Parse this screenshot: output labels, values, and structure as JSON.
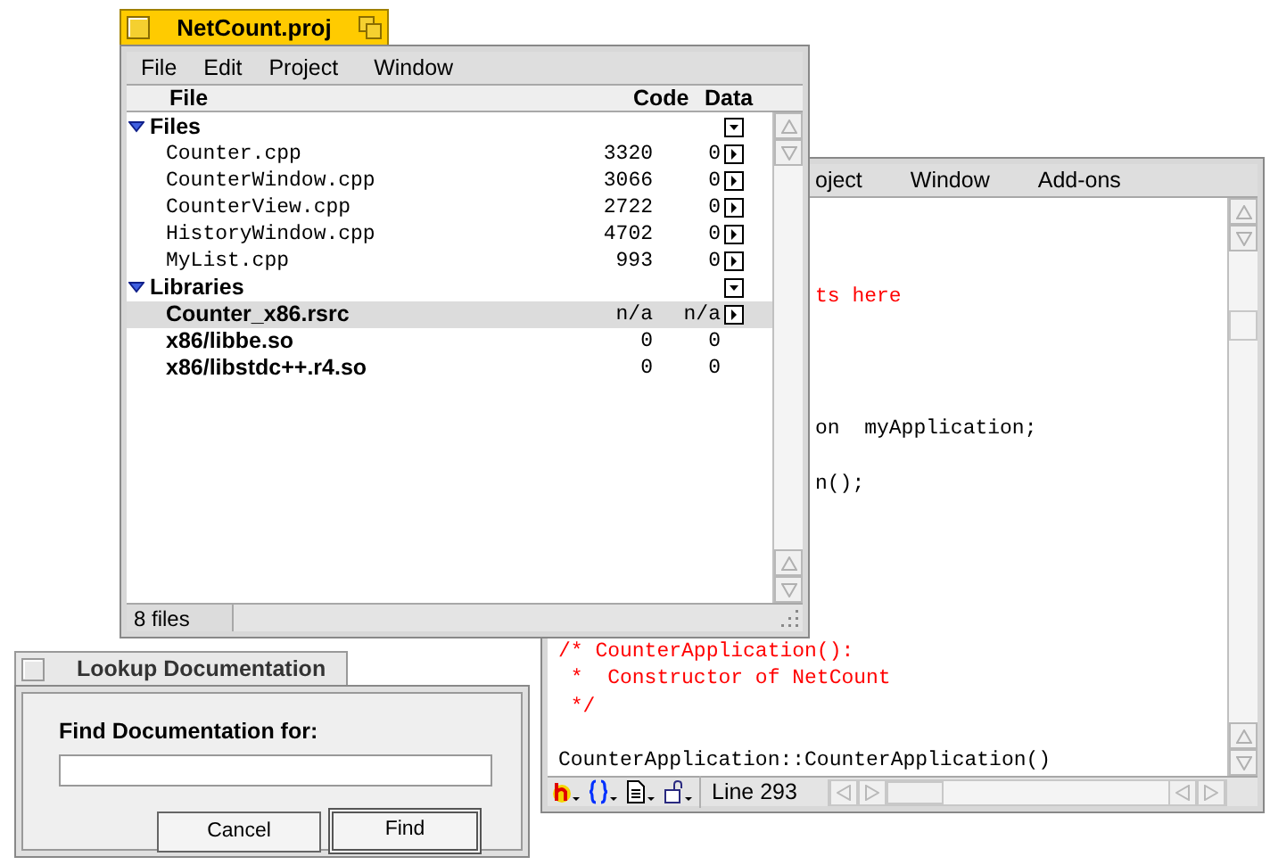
{
  "editor_window": {
    "menu": [
      "oject",
      "Window",
      "Add-ons"
    ],
    "lines_right": [
      {
        "text": "ts here",
        "kind": "comment"
      },
      {
        "text": "on  myApplication;",
        "kind": "code"
      },
      {
        "text": "n();",
        "kind": "code"
      }
    ],
    "lines_below": [
      {
        "text": "/* CounterApplication():",
        "kind": "comment"
      },
      {
        "text": " *  Constructor of NetCount",
        "kind": "comment"
      },
      {
        "text": " */",
        "kind": "comment"
      },
      {
        "text": "CounterApplication::CounterApplication()",
        "kind": "code"
      }
    ],
    "status": "Line 293"
  },
  "project_window": {
    "title": "NetCount.proj",
    "active": true,
    "menu": [
      "File",
      "Edit",
      "Project",
      "Window"
    ],
    "columns": [
      "File",
      "Code",
      "Data"
    ],
    "groups": [
      {
        "name": "Files",
        "expanded": true,
        "items": [
          {
            "name": "Counter.cpp",
            "kind": "source",
            "code": "3320",
            "data": "0",
            "has_arrow": true,
            "selected": false
          },
          {
            "name": "CounterWindow.cpp",
            "kind": "source",
            "code": "3066",
            "data": "0",
            "has_arrow": true,
            "selected": false
          },
          {
            "name": "CounterView.cpp",
            "kind": "source",
            "code": "2722",
            "data": "0",
            "has_arrow": true,
            "selected": false
          },
          {
            "name": "HistoryWindow.cpp",
            "kind": "source",
            "code": "4702",
            "data": "0",
            "has_arrow": true,
            "selected": false
          },
          {
            "name": "MyList.cpp",
            "kind": "source",
            "code": "993",
            "data": "0",
            "has_arrow": true,
            "selected": false
          }
        ]
      },
      {
        "name": "Libraries",
        "expanded": true,
        "items": [
          {
            "name": "Counter_x86.rsrc",
            "kind": "library",
            "code": "n/a",
            "data": "n/a",
            "has_arrow": true,
            "selected": true
          },
          {
            "name": "x86/libbe.so",
            "kind": "library",
            "code": "0",
            "data": "0",
            "has_arrow": false,
            "selected": false
          },
          {
            "name": "x86/libstdc++.r4.so",
            "kind": "library",
            "code": "0",
            "data": "0",
            "has_arrow": false,
            "selected": false
          }
        ]
      }
    ],
    "status": "8 files"
  },
  "lookup_window": {
    "title": "Lookup Documentation",
    "active": false,
    "label": "Find Documentation for:",
    "buttons": [
      {
        "label": "Cancel",
        "default": false
      },
      {
        "label": "Find",
        "default": true
      }
    ]
  }
}
